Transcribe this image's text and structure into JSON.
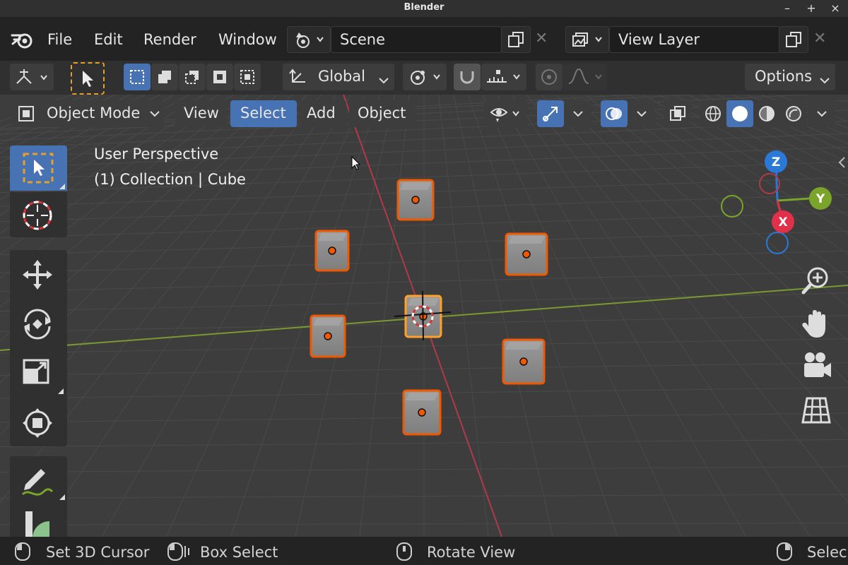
{
  "window": {
    "title": "Blender",
    "minimize": "–",
    "maximize": "+",
    "close": "×"
  },
  "menubar": {
    "items": [
      "File",
      "Edit",
      "Render",
      "Window"
    ],
    "scene_name": "Scene",
    "view_layer": "View Layer"
  },
  "header": {
    "transform_orientation": "Global",
    "options_label": "Options",
    "mode": "Object Mode",
    "menus": [
      "View",
      "Select",
      "Add",
      "Object"
    ],
    "active_menu": "Select"
  },
  "viewport": {
    "perspective": "User Perspective",
    "collection_info": "(1) Collection | Cube",
    "gizmo_labels": {
      "z": "Z",
      "y": "Y",
      "x": "X"
    }
  },
  "statusbar": {
    "items": [
      "Set 3D Cursor",
      "Box Select",
      "Rotate View",
      "Selec"
    ]
  },
  "colors": {
    "accent_blue": "#4772b3",
    "selection_orange": "#f15800",
    "active_orange": "#ffa028",
    "axis_red": "#b03a48",
    "axis_green": "#7a9a2f"
  },
  "icons": {
    "logo": "blender-logo-icon",
    "tools": [
      "select-box-icon",
      "cursor-icon",
      "move-icon",
      "rotate-icon",
      "scale-icon",
      "transform-icon",
      "annotate-icon",
      "measure-icon"
    ],
    "nav": [
      "zoom-icon",
      "pan-hand-icon",
      "camera-icon",
      "grid-view-icon"
    ]
  }
}
